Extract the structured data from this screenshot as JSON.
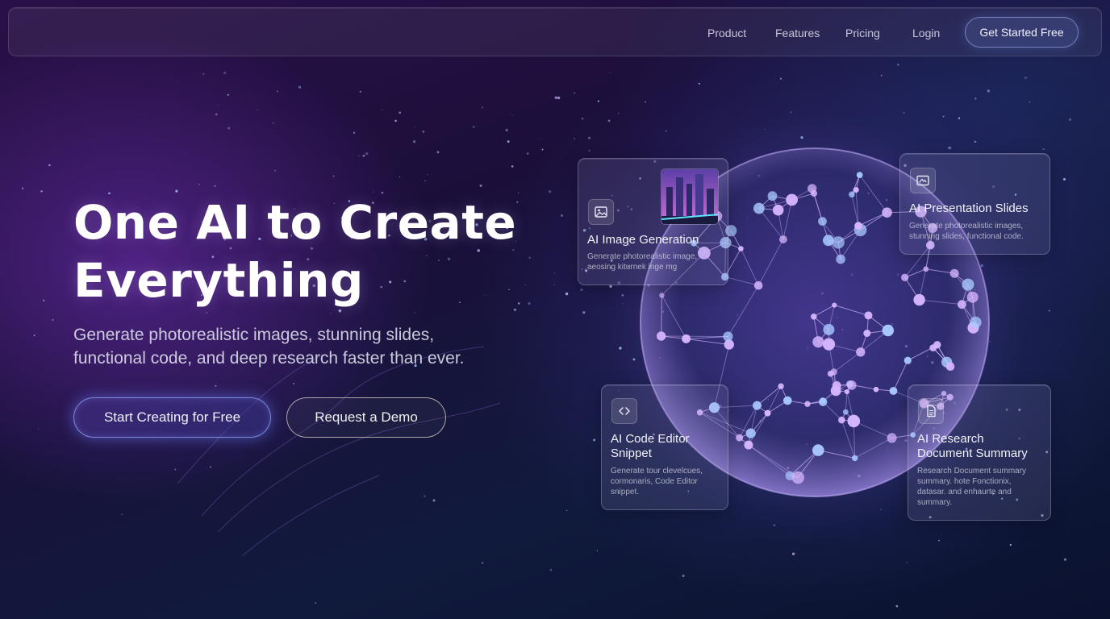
{
  "nav": {
    "links": [
      "Product",
      "Features",
      "Pricing",
      "Login"
    ],
    "cta": "Get Started Free"
  },
  "hero": {
    "title_line1": "One AI to Create",
    "title_line2": "Everything",
    "subtitle_line1": "Generate photorealistic images, stunning slides,",
    "subtitle_line2": "functional code, and deep research faster than ever.",
    "primary_button": "Start Creating for Free",
    "secondary_button": "Request a Demo"
  },
  "cards": {
    "image_gen": {
      "icon": "image-icon",
      "title": "AI Image Generation",
      "desc_line1": "Generate photorealistic image,",
      "desc_line2": "aeosing kiturnek inge mg"
    },
    "slides": {
      "icon": "slides-icon",
      "title": "AI Presentation Slides",
      "desc_line1": "Generate photorealistic images,",
      "desc_line2": "stunning slides, functional code."
    },
    "code": {
      "icon": "code-icon",
      "title_line1": "AI Code Editor",
      "title_line2": "Snippet",
      "desc_line1": "Generate tour clevelcues,",
      "desc_line2": "cormonaris, Code Editor",
      "desc_line3": "snippet."
    },
    "research": {
      "icon": "document-icon",
      "title_line1": "AI Research",
      "title_line2": "Document Summary",
      "desc_line1": "Research Document summary",
      "desc_line2": "summary. hote Fonctionix,",
      "desc_line3": "datasar. and enhaurte and",
      "desc_line4": "summary."
    }
  },
  "colors": {
    "accent": "#9b7dff",
    "node": "#c9a8ff",
    "background_top": "#2a1048",
    "background_bottom": "#0b1230"
  }
}
